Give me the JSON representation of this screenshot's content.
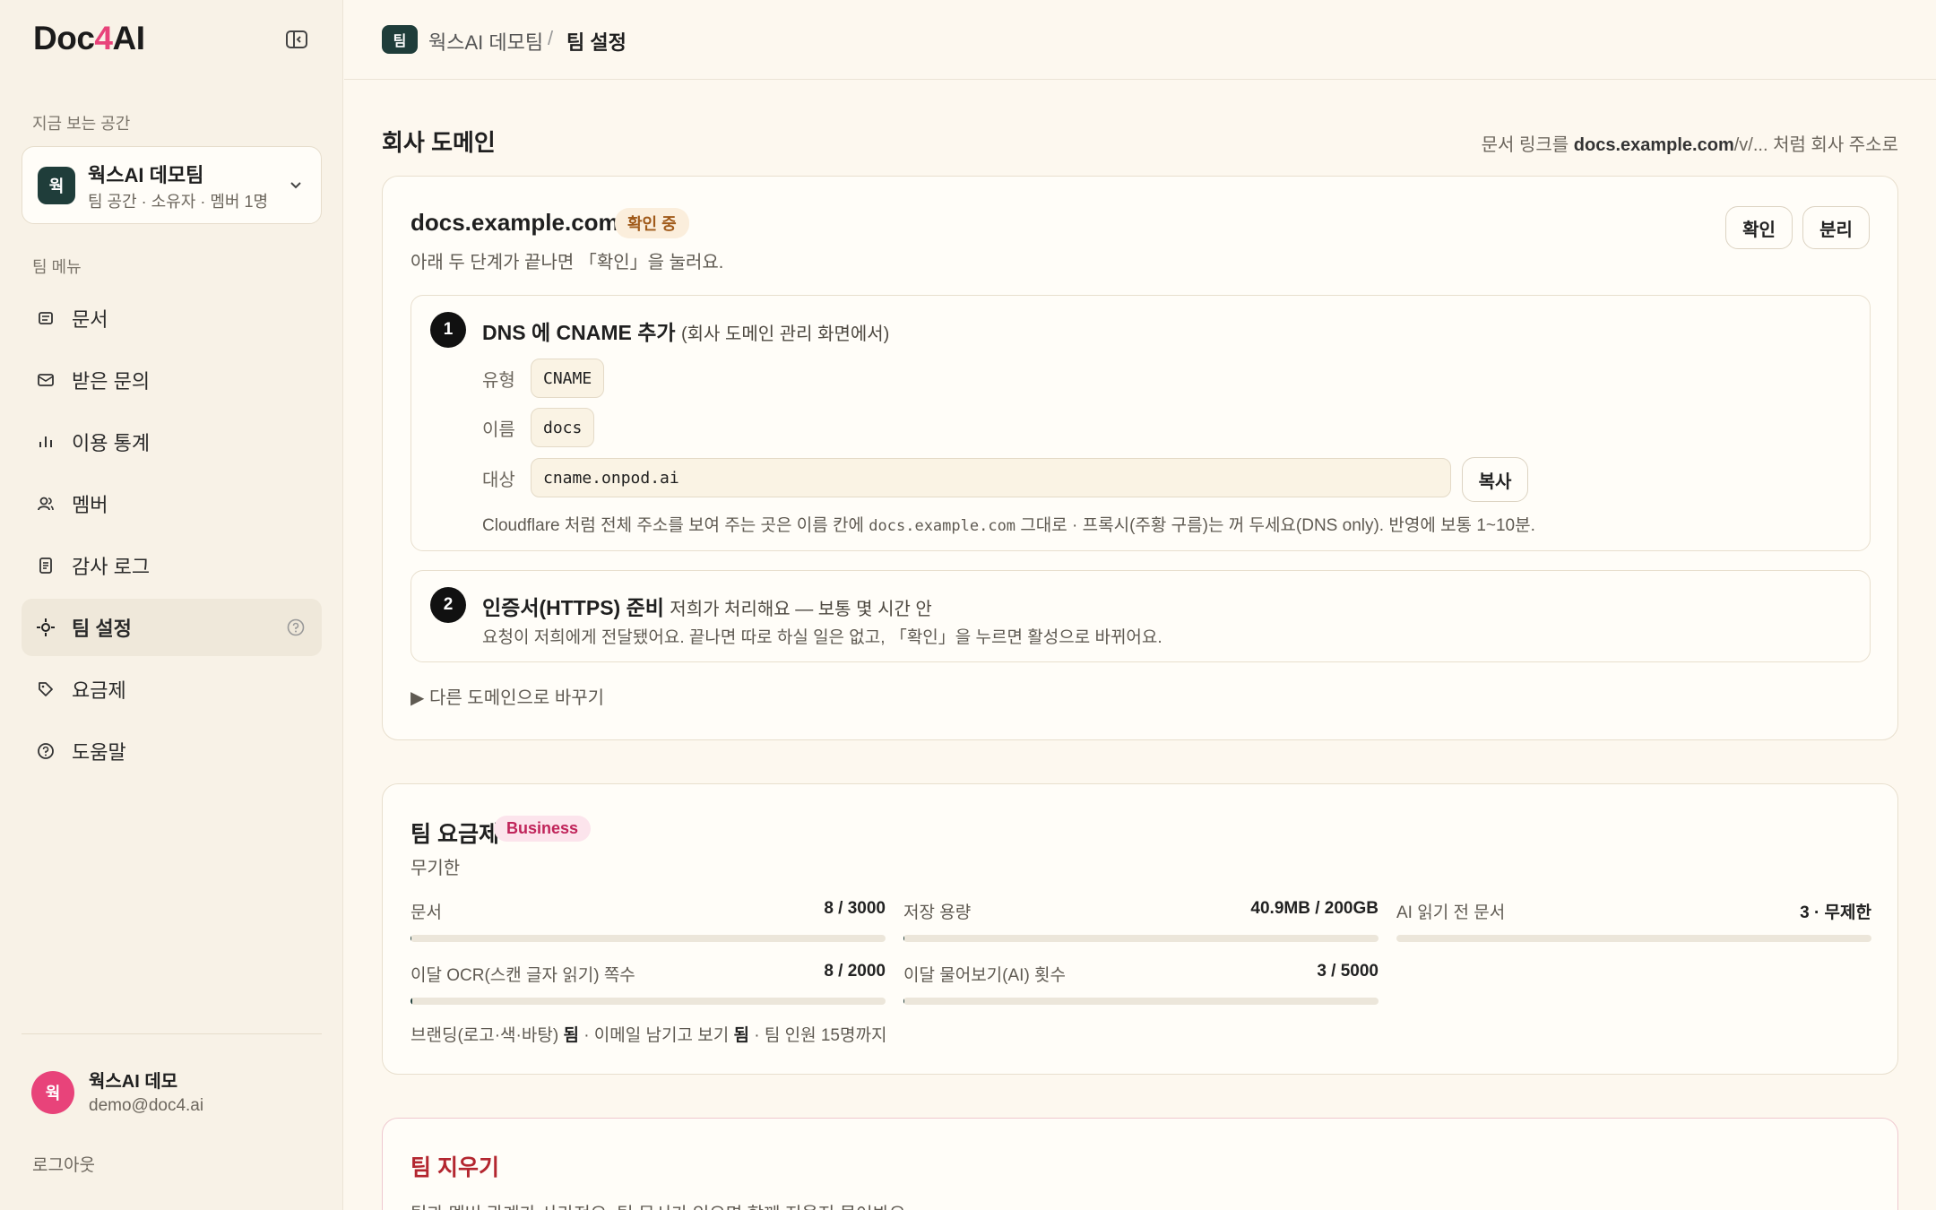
{
  "brand": {
    "prefix": "Doc",
    "four": "4",
    "suffix": "AI"
  },
  "sidebar": {
    "current_space_label": "지금 보는 공간",
    "workspace": {
      "avatar": "웍",
      "name": "웍스AI 데모팀",
      "sub": "팀 공간 · 소유자 · 멤버 1명"
    },
    "menu_label": "팀 메뉴",
    "items": [
      {
        "label": "문서",
        "icon": "document-icon"
      },
      {
        "label": "받은 문의",
        "icon": "mail-icon"
      },
      {
        "label": "이용 통계",
        "icon": "bar-chart-icon"
      },
      {
        "label": "멤버",
        "icon": "users-icon"
      },
      {
        "label": "감사 로그",
        "icon": "log-icon"
      },
      {
        "label": "팀 설정",
        "icon": "settings-icon",
        "active": true
      },
      {
        "label": "요금제",
        "icon": "tag-icon"
      },
      {
        "label": "도움말",
        "icon": "help-icon"
      }
    ],
    "user": {
      "avatar": "웍",
      "name": "웍스AI 데모",
      "email": "demo@doc4.ai"
    },
    "logout": "로그아웃"
  },
  "topbar": {
    "badge": "팀",
    "team": "웍스AI 데모팀",
    "separator": "/",
    "current": "팀 설정"
  },
  "domain_section": {
    "title": "회사 도메인",
    "hint_prefix": "문서 링크를 ",
    "hint_bold": "docs.example.com",
    "hint_suffix": "/v/... 처럼 회사 주소로",
    "domain": "docs.example.com",
    "status": "확인 중",
    "desc": "아래 두 단계가 끝나면 「확인」을 눌러요.",
    "verify_button": "확인",
    "detach_button": "분리",
    "step1": {
      "num": "1",
      "title": "DNS 에 CNAME 추가",
      "sub": "(회사 도메인 관리 화면에서)",
      "type_label": "유형",
      "type_value": "CNAME",
      "name_label": "이름",
      "name_value": "docs",
      "target_label": "대상",
      "target_value": "cname.onpod.ai",
      "copy_button": "복사",
      "note_prefix": "Cloudflare 처럼 전체 주소를 보여 주는 곳은 이름 칸에 ",
      "note_code": "docs.example.com",
      "note_suffix": " 그대로 · 프록시(주황 구름)는 꺼 두세요(DNS only). 반영에 보통 1~10분."
    },
    "step2": {
      "num": "2",
      "title": "인증서(HTTPS) 준비",
      "sub": "저희가 처리해요 — 보통 몇 시간 안",
      "desc": "요청이 저희에게 전달됐어요. 끝나면 따로 하실 일은 없고, 「확인」을 누르면 활성으로 바뀌어요."
    },
    "other_domain": "▶ 다른 도메인으로 바꾸기"
  },
  "plan": {
    "title": "팀 요금제",
    "badge": "Business",
    "sub": "무기한",
    "meters": [
      {
        "label": "문서",
        "value": "8 / 3000",
        "fraction": 0.0027
      },
      {
        "label": "저장 용량",
        "value": "40.9MB / 200GB",
        "fraction": 0.0002
      },
      {
        "label": "AI 읽기 전 문서",
        "value": "3 · 무제한",
        "fraction": 0
      },
      {
        "label": "이달 OCR(스캔 글자 읽기) 쪽수",
        "value": "8 / 2000",
        "fraction": 0.004
      },
      {
        "label": "이달 물어보기(AI) 횟수",
        "value": "3 / 5000",
        "fraction": 0.0006
      }
    ],
    "features": {
      "branding": "브랜딩(로고·색·바탕) ",
      "branding_v": "됨",
      "email": " · 이메일 남기고 보기 ",
      "email_v": "됨",
      "members": " · 팀 인원 15명까지"
    }
  },
  "danger": {
    "title": "팀 지우기",
    "desc": "팀과 멤버 관계가 사라져요. 팀 문서가 있으면 함께 지울지 물어봐요."
  },
  "colors": {
    "accent": "#1f3d3a",
    "brand_pink": "#e8437a",
    "danger": "#b3262f"
  }
}
